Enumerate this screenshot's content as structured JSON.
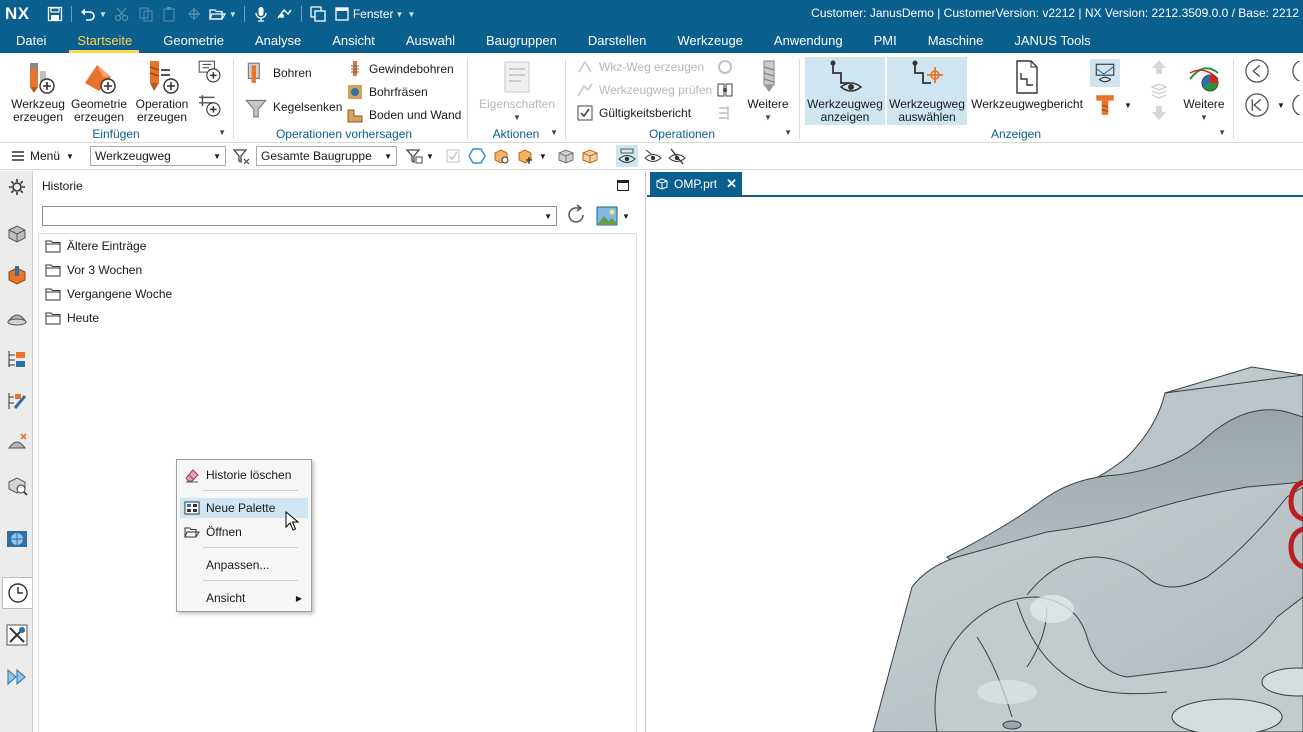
{
  "app": {
    "logo": "NX",
    "window_menu": "Fenster",
    "status_text": "Customer: JanusDemo | CustomerVersion: v2212 | NX Version: 2212.3509.0.0 / Base: 2212"
  },
  "menu_tabs": [
    {
      "label": "Datei"
    },
    {
      "label": "Startseite"
    },
    {
      "label": "Geometrie"
    },
    {
      "label": "Analyse"
    },
    {
      "label": "Ansicht"
    },
    {
      "label": "Auswahl"
    },
    {
      "label": "Baugruppen"
    },
    {
      "label": "Darstellen"
    },
    {
      "label": "Werkzeuge"
    },
    {
      "label": "Anwendung"
    },
    {
      "label": "PMI"
    },
    {
      "label": "Maschine"
    },
    {
      "label": "JANUS Tools"
    }
  ],
  "active_tab": "Startseite",
  "ribbon": {
    "einfuegen": {
      "label": "Einfügen",
      "werkzeug": "Werkzeug erzeugen",
      "geometrie": "Geometrie erzeugen",
      "operation": "Operation erzeugen"
    },
    "vorhersagen": {
      "label": "Operationen vorhersagen",
      "bohren": "Bohren",
      "kegelsenken": "Kegelsenken",
      "gewindebohren": "Gewindebohren",
      "bohrfraesen": "Bohrfräsen",
      "boden_wand": "Boden und Wand"
    },
    "aktionen": {
      "label": "Aktionen",
      "eigenschaften": "Eigenschaften"
    },
    "operationen": {
      "label": "Operationen",
      "wkz_weg": "Wkz-Weg erzeugen",
      "pruefen": "Werkzeugweg prüfen",
      "gueltigkeit": "Gültigkeitsbericht",
      "weitere": "Weitere"
    },
    "anzeigen": {
      "label": "Anzeigen",
      "anzeigen": "Werkzeugweg anzeigen",
      "auswaehlen": "Werkzeugweg auswählen",
      "bericht": "Werkzeugwegbericht",
      "weitere": "Weitere"
    }
  },
  "selection_bar": {
    "menu": "Menü",
    "filter_type": "Werkzeugweg",
    "scope": "Gesamte Baugruppe"
  },
  "history_panel": {
    "title": "Historie",
    "filter_value": "",
    "folders": [
      {
        "label": "Ältere Einträge"
      },
      {
        "label": "Vor 3 Wochen"
      },
      {
        "label": "Vergangene Woche"
      },
      {
        "label": "Heute"
      }
    ]
  },
  "context_menu": {
    "items": [
      {
        "label": "Historie löschen"
      },
      {
        "label": "Neue Palette"
      },
      {
        "label": "Öffnen"
      },
      {
        "label": "Anpassen..."
      },
      {
        "label": "Ansicht"
      }
    ],
    "highlighted": "Neue Palette"
  },
  "document": {
    "tab_label": "OMP.prt"
  },
  "colors": {
    "brand_blue": "#0a5f8e",
    "active_tab": "#ffd34d",
    "group_label": "#0a5f8e",
    "highlight": "#cde6f2",
    "model_grey": "#b8c2c6"
  }
}
